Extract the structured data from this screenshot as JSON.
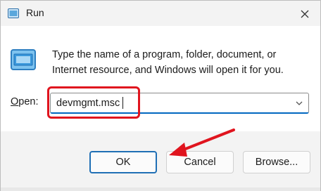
{
  "window": {
    "title": "Run"
  },
  "content": {
    "description": "Type the name of a program, folder, document, or Internet resource, and Windows will open it for you.",
    "open_label_underline": "O",
    "open_label_rest": "pen:",
    "open_value": "devmgmt.msc"
  },
  "buttons": {
    "ok_label": "OK",
    "cancel_label": "Cancel",
    "browse_label": "Browse..."
  },
  "colors": {
    "annotation_red": "#e0141e",
    "accent_blue": "#0067c0"
  }
}
